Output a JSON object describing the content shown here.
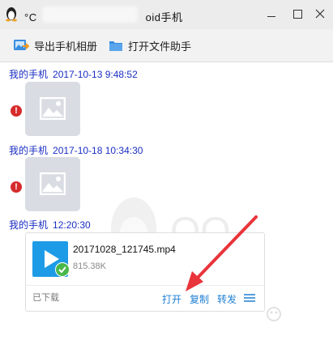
{
  "window": {
    "title_prefix": "°C",
    "title_suffix": "oid手机"
  },
  "toolbar": {
    "export_label": "导出手机相册",
    "open_label": "打开文件助手"
  },
  "messages": [
    {
      "sender": "我的手机",
      "time": "2017-10-13 9:48:52"
    },
    {
      "sender": "我的手机",
      "time": "2017-10-18 10:34:30"
    },
    {
      "sender": "我的手机",
      "time": "12:20:30"
    }
  ],
  "error_mark": "!",
  "watermark": {
    "text": "QQ"
  },
  "file": {
    "name": "20171028_121745.mp4",
    "size": "815.38K",
    "status": "已下载",
    "actions": {
      "open": "打开",
      "copy": "复制",
      "forward": "转发"
    }
  },
  "colors": {
    "sender": "#1a2ec4",
    "action": "#1e7fd4",
    "file_icon": "#1e9be6",
    "arrow": "#e8353b"
  },
  "icons": [
    "qq-penguin-icon",
    "export-album-icon",
    "folder-icon",
    "image-placeholder-icon",
    "error-icon",
    "video-play-icon",
    "check-icon",
    "menu-icon"
  ]
}
